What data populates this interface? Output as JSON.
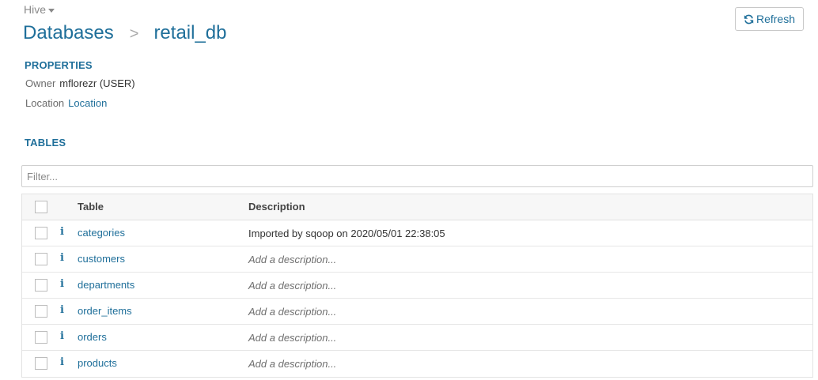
{
  "header": {
    "engine": "Hive",
    "breadcrumb": {
      "root": "Databases",
      "separator": ">",
      "current": "retail_db"
    },
    "refresh_label": "Refresh"
  },
  "properties": {
    "title": "PROPERTIES",
    "owner_key": "Owner",
    "owner_value": "mflorezr (USER)",
    "location_key": "Location",
    "location_link": "Location"
  },
  "tables": {
    "title": "TABLES",
    "filter_placeholder": "Filter...",
    "columns": {
      "table": "Table",
      "description": "Description"
    },
    "rows": [
      {
        "name": "categories",
        "description": "Imported by sqoop on 2020/05/01 22:38:05",
        "has_description": true
      },
      {
        "name": "customers",
        "description": "Add a description...",
        "has_description": false
      },
      {
        "name": "departments",
        "description": "Add a description...",
        "has_description": false
      },
      {
        "name": "order_items",
        "description": "Add a description...",
        "has_description": false
      },
      {
        "name": "orders",
        "description": "Add a description...",
        "has_description": false
      },
      {
        "name": "products",
        "description": "Add a description...",
        "has_description": false
      }
    ]
  },
  "colors": {
    "accent": "#1f6f9a",
    "muted": "#8a8a8a"
  },
  "icons": {
    "refresh": "refresh-icon",
    "info": "info-icon",
    "dropdown": "caret-down-icon"
  }
}
